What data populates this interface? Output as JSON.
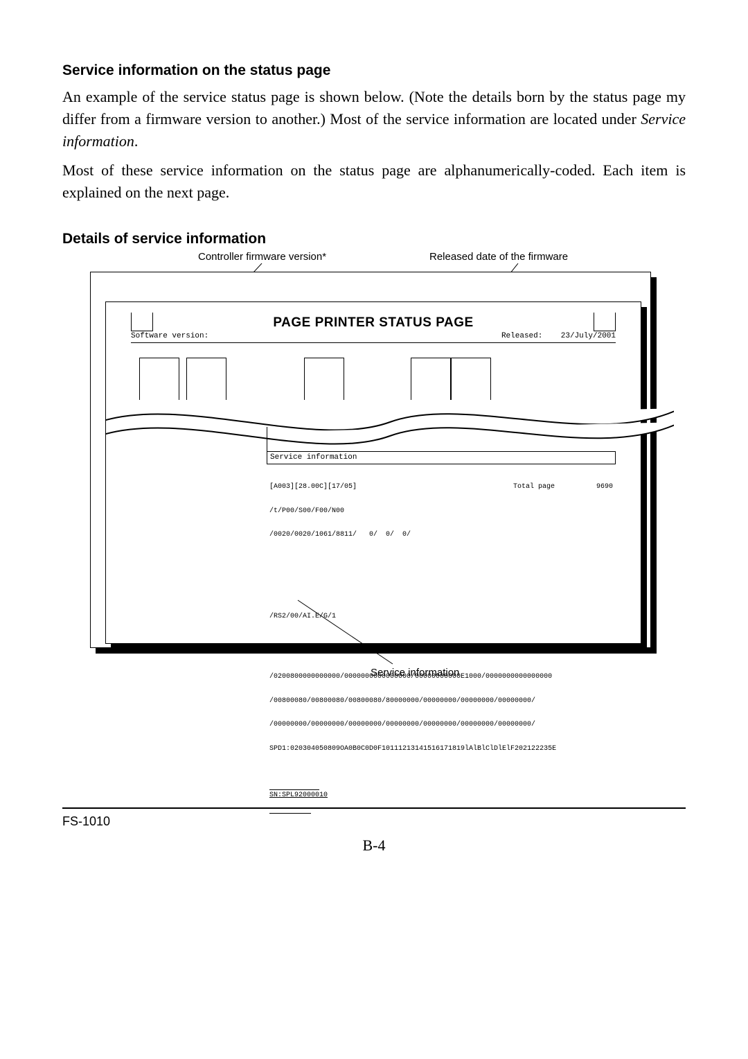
{
  "headings": {
    "section1": "Service information on the status page",
    "section2": "Details of service information"
  },
  "paragraphs": {
    "p1a": "An example of the service status page is shown below. (Note the details born by the status page my differ from a firmware version to another.) Most of the service information are located under ",
    "p1b_italic": "Service information",
    "p1c": ".",
    "p2": "Most of these service information on the status page are alphanumerically-coded. Each item is explained on the next page."
  },
  "callouts": {
    "firmware_version": "Controller firmware version*",
    "release_date": "Released date of the firmware",
    "service_info": "Service information"
  },
  "status_page": {
    "title": "PAGE PRINTER   STATUS PAGE",
    "sw_label": "Software version:",
    "released_label": "Released:",
    "released_value": "23/July/2001"
  },
  "service_info": {
    "header": "Service information",
    "line1": "[A003][28.00C][17/05]",
    "line2": "/t/P00/S00/F00/N00",
    "line3": "/0020/0020/1061/8811/   0/  0/  0/",
    "total_label": "Total page",
    "total_value": "9690",
    "rs_line": "/RS2/00/AI.E/G/1",
    "hex1": "/0200800000000000/0000000000000000/00000000000E1000/0000000000000000",
    "hex2": "/00800080/00800080/00800080/80000000/00000000/00000000/00000000/",
    "hex3": "/00000000/00000000/00000000/00000000/00000000/00000000/00000000/",
    "hex4": "SPD1:020304050809OA0B0C0D0F10111213141516171819lAlBlClDlElF202122235E",
    "sn": "SN:SPL92000010"
  },
  "footer": {
    "model": "FS-1010",
    "page_num": "B-4"
  }
}
